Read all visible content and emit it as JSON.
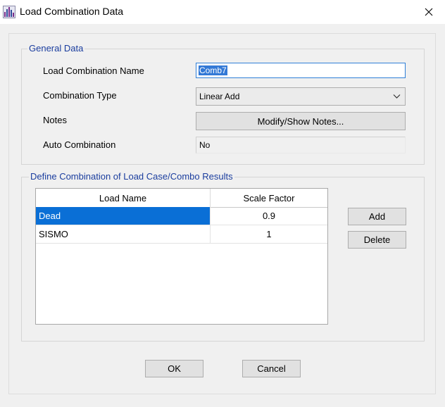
{
  "window": {
    "title": "Load Combination Data"
  },
  "general": {
    "title": "General Data",
    "name_label": "Load Combination Name",
    "name_value": "Comb7",
    "type_label": "Combination Type",
    "type_value": "Linear Add",
    "notes_label": "Notes",
    "notes_button": "Modify/Show Notes...",
    "auto_label": "Auto Combination",
    "auto_value": "No"
  },
  "define": {
    "title": "Define Combination of Load Case/Combo Results",
    "columns": [
      "Load Name",
      "Scale Factor"
    ],
    "rows": [
      {
        "name": "Dead",
        "factor": "0.9"
      },
      {
        "name": "SISMO",
        "factor": "1"
      }
    ],
    "add_button": "Add",
    "delete_button": "Delete"
  },
  "footer": {
    "ok": "OK",
    "cancel": "Cancel"
  },
  "colors": {
    "accent": "#1a3d9e",
    "selection": "#0a6fd6",
    "text_selection": "#3379d6"
  }
}
